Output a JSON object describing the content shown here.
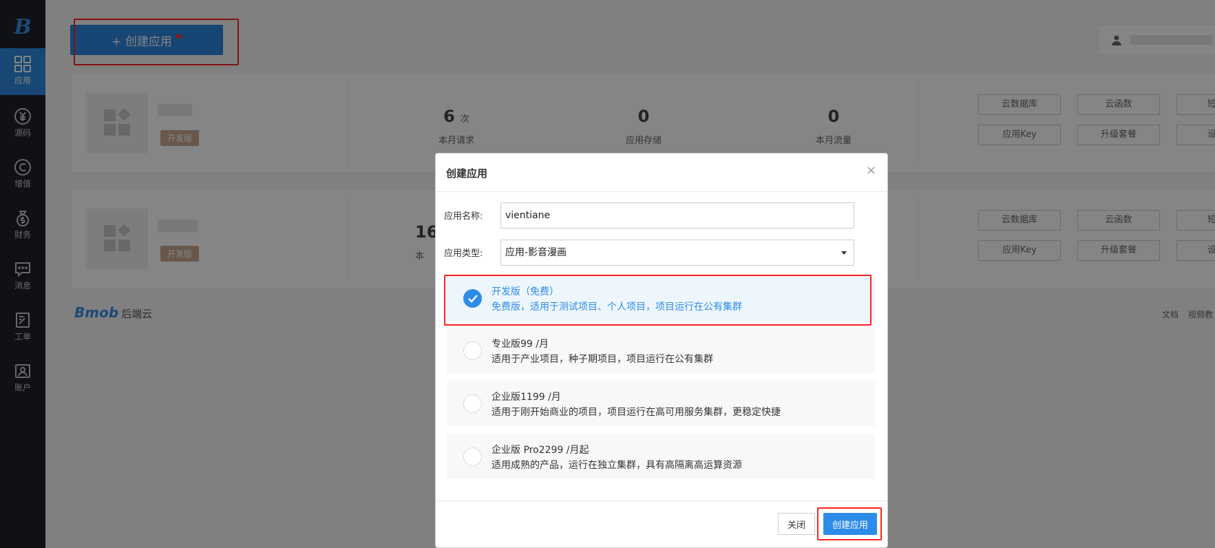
{
  "sidebar": {
    "logo": "B",
    "items": [
      {
        "label": "应用",
        "icon": "grid-icon"
      },
      {
        "label": "源码",
        "icon": "yuan-coin-icon"
      },
      {
        "label": "增值",
        "icon": "copyright-icon"
      },
      {
        "label": "财务",
        "icon": "money-bag-icon"
      },
      {
        "label": "消息",
        "icon": "chat-icon"
      },
      {
        "label": "工单",
        "icon": "edit-note-icon"
      },
      {
        "label": "账户",
        "icon": "user-card-icon"
      }
    ]
  },
  "header": {
    "create_label": "+ 创建应用"
  },
  "apps": [
    {
      "badge": "开发版",
      "stats": [
        {
          "num": "6",
          "unit": "次",
          "label": "本月请求"
        },
        {
          "num": "0",
          "unit": "",
          "label": "应用存储"
        },
        {
          "num": "0",
          "unit": "",
          "label": "本月流量"
        }
      ],
      "buttons": [
        "云数据库",
        "云函数",
        "短",
        "应用Key",
        "升级套餐",
        "设"
      ]
    },
    {
      "badge": "开发版",
      "stats": [
        {
          "num": "16",
          "unit": "",
          "label": "本"
        }
      ],
      "buttons": [
        "云数据库",
        "云函数",
        "短",
        "应用Key",
        "升级套餐",
        "设"
      ]
    }
  ],
  "footer": {
    "logo": "Bmob",
    "logo_suffix": "后端云",
    "links": [
      "文档",
      "视频教"
    ]
  },
  "modal": {
    "title": "创建应用",
    "close_symbol": "×",
    "name_label": "应用名称:",
    "name_value": "vientiane",
    "type_label": "应用类型:",
    "type_value": "应用-影音漫画",
    "plans": [
      {
        "title": "开发版（免费）",
        "desc": "免费版，适用于测试项目、个人项目，项目运行在公有集群",
        "selected": true
      },
      {
        "title": "专业版99 /月",
        "desc": "适用于产业项目，种子期项目，项目运行在公有集群",
        "selected": false
      },
      {
        "title": "企业版1199 /月",
        "desc": "适用于刚开始商业的项目，项目运行在高可用服务集群，更稳定快捷",
        "selected": false
      },
      {
        "title": "企业版 Pro2299 /月起",
        "desc": "适用成熟的产品，运行在独立集群，具有高隔离高运算资源",
        "selected": false
      }
    ],
    "close_button": "关闭",
    "create_button": "创建应用"
  },
  "colors": {
    "primary": "#2d8ce8",
    "sidebar": "#1f2228",
    "highlight": "#ff2020",
    "badge": "#c8a98e"
  }
}
